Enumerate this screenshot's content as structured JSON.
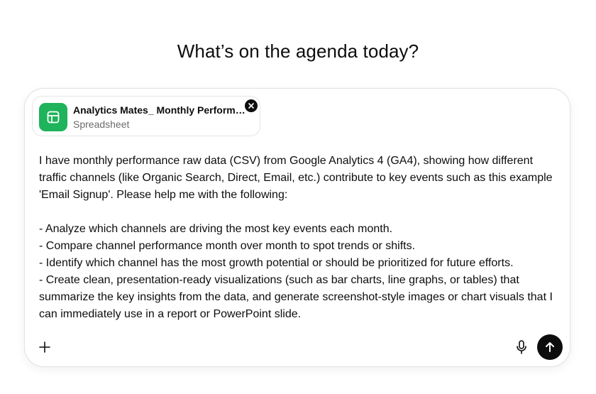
{
  "heading": "What’s on the agenda today?",
  "attachment": {
    "name": "Analytics Mates_ Monthly Performance",
    "type": "Spreadsheet",
    "icon": "spreadsheet-icon",
    "icon_color": "#1fb35b"
  },
  "prompt": "I have monthly performance raw data (CSV) from Google Analytics 4 (GA4), showing how different traffic channels (like Organic Search, Direct, Email, etc.) contribute to key events such as this example 'Email Signup'. Please help me with the following:\n\n- Analyze which channels are driving the most key events each month.\n- Compare channel performance month over month to spot trends or shifts.\n- Identify which channel has the most growth potential or should be prioritized for future efforts.\n- Create clean, presentation-ready visualizations (such as bar charts, line graphs, or tables) that summarize the key insights from the data, and generate screenshot-style images or chart visuals that I can immediately use in a report or PowerPoint slide.",
  "icons": {
    "add": "plus-icon",
    "voice": "microphone-icon",
    "send": "arrow-up-icon",
    "remove": "close-icon"
  },
  "colors": {
    "send_button": "#0d0d0d",
    "border": "#e3e3e3"
  }
}
